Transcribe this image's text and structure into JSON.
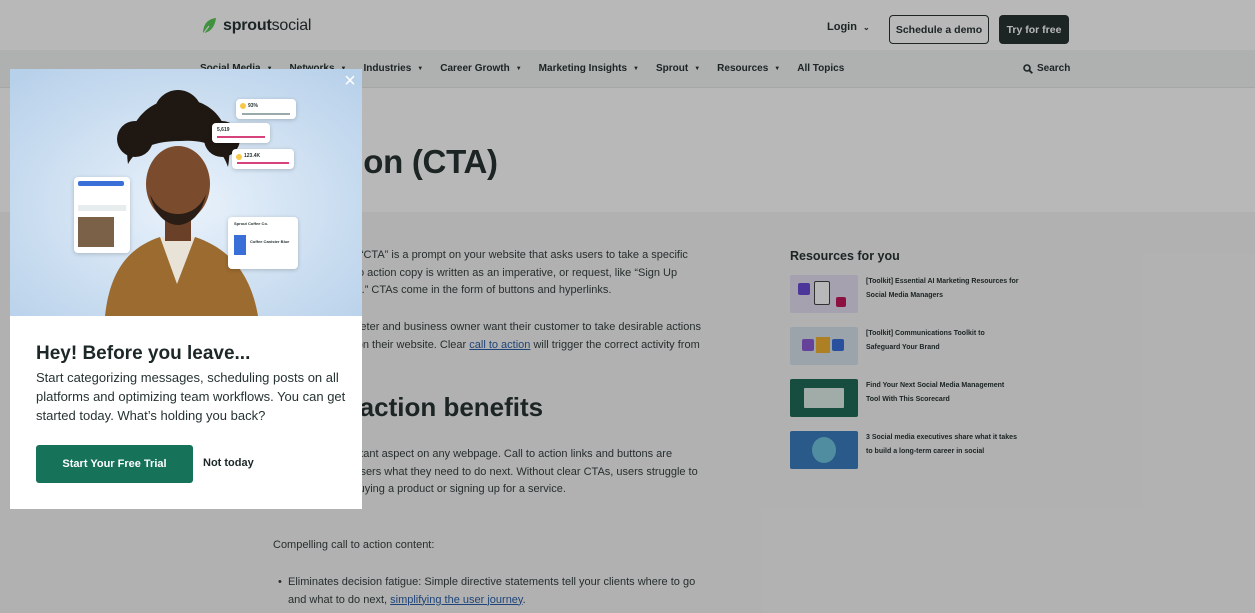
{
  "header": {
    "logo_bold": "sprout",
    "logo_light": "social",
    "login_label": "Login",
    "demo_label": "Schedule a demo",
    "try_label": "Try for free"
  },
  "nav": {
    "items": [
      {
        "label": "Social Media"
      },
      {
        "label": "Networks"
      },
      {
        "label": "Industries"
      },
      {
        "label": "Career Growth"
      },
      {
        "label": "Marketing Insights"
      },
      {
        "label": "Sprout"
      },
      {
        "label": "Resources"
      },
      {
        "label": "All Topics"
      }
    ],
    "search_label": "Search"
  },
  "article": {
    "title": "Call to action (CTA)",
    "p1": "A call to action or “CTA” is a prompt on your website that asks users to take a specific action. Most call to action copy is written as an imperative, or request, like “Sign Up Now” or “Buy Now.” CTAs come in the form of buttons and hyperlinks.",
    "p2_before": "Every digital marketer and business owner want their customer to take desirable actions when they arrive on their website. Clear ",
    "p2_link": "call to action",
    "p2_after": " will trigger the correct activity from your audience.",
    "h2": "Call to action benefits",
    "p3": "A CTA is an important aspect on any webpage. Call to action links and buttons are signposts telling users what they need to do next. Without clear CTAs, users struggle to see the route to buying a product or signing up for a service.",
    "p4": "Compelling call to action content:",
    "bullet_before": "Eliminates decision fatigue: Simple directive statements tell your clients where to go and what to do next, ",
    "bullet_link": "simplifying the user journey",
    "bullet_after": "."
  },
  "resources": {
    "title": "Resources for you",
    "items": [
      {
        "label": "[Toolkit] Essential AI Marketing Resources for Social Media Managers",
        "color": "#e6e0f2"
      },
      {
        "label": "[Toolkit] Communications Toolkit to Safeguard Your Brand",
        "color": "#d9e4ee"
      },
      {
        "label": "Find Your Next Social Media Management Tool With This Scorecard",
        "color": "#1f6b57"
      },
      {
        "label": "3 Social media executives share what it takes to build a long-term career in social",
        "color": "#3a7dbf"
      }
    ]
  },
  "modal": {
    "heading": "Hey! Before you leave...",
    "body": "Start categorizing messages, scheduling posts on all platforms and optimizing team workflows. You can get started today. What’s holding you back?",
    "cta_label": "Start Your Free Trial",
    "dismiss_label": "Not today",
    "close_glyph": "×",
    "image_cards": {
      "percent": "93%",
      "count_a": "5,619",
      "count_b": "123.4K",
      "account": "Sprout Coffee Co.",
      "product": "Coffee Canister Blue"
    }
  },
  "colors": {
    "brand_green": "#17725a",
    "dark": "#273333",
    "link": "#2b5fa8"
  }
}
